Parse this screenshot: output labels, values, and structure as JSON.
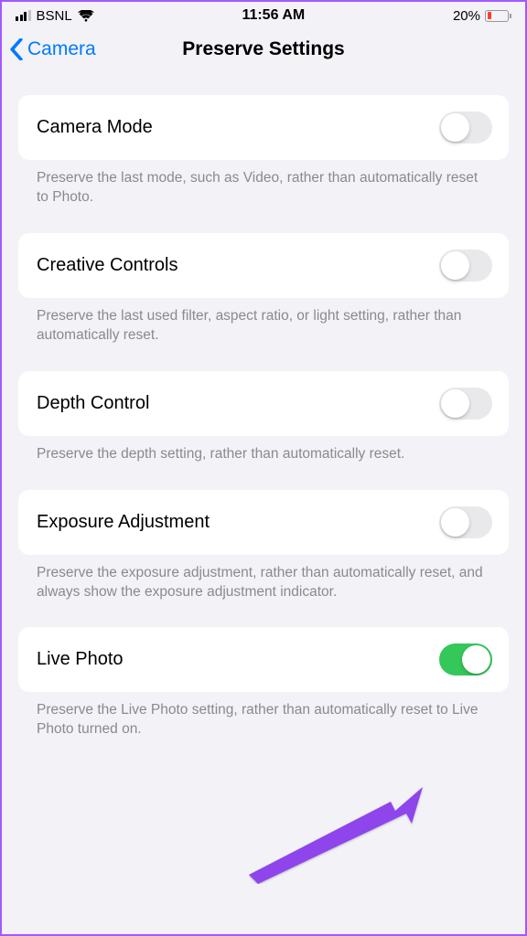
{
  "status": {
    "carrier": "BSNL",
    "time": "11:56 AM",
    "batteryPercent": "20%"
  },
  "nav": {
    "back": "Camera",
    "title": "Preserve Settings"
  },
  "groups": [
    {
      "label": "Camera Mode",
      "footer": "Preserve the last mode, such as Video, rather than automatically reset to Photo.",
      "on": false
    },
    {
      "label": "Creative Controls",
      "footer": "Preserve the last used filter, aspect ratio, or light setting, rather than automatically reset.",
      "on": false
    },
    {
      "label": "Depth Control",
      "footer": "Preserve the depth setting, rather than automatically reset.",
      "on": false
    },
    {
      "label": "Exposure Adjustment",
      "footer": "Preserve the exposure adjustment, rather than automatically reset, and always show the exposure adjustment indicator.",
      "on": false
    },
    {
      "label": "Live Photo",
      "footer": "Preserve the Live Photo setting, rather than automatically reset to Live Photo turned on.",
      "on": true
    }
  ]
}
